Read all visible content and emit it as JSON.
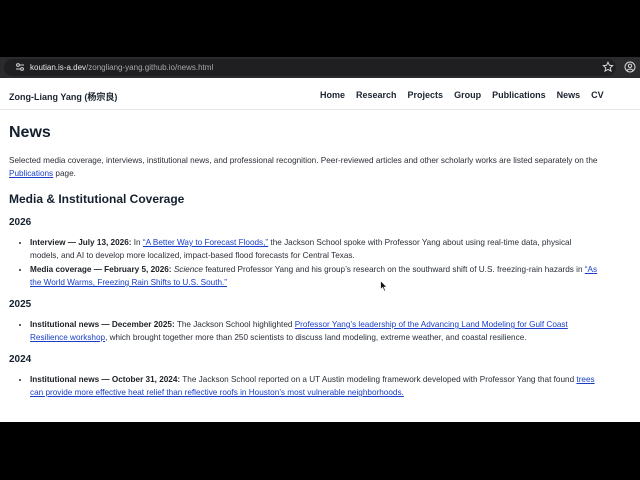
{
  "browser": {
    "url_host": "koutian.is-a.dev",
    "url_path": "/zongliang-yang.github.io/news.html"
  },
  "nav": {
    "brand": "Zong-Liang Yang (杨宗良)",
    "links": [
      "Home",
      "Research",
      "Projects",
      "Group",
      "Publications",
      "News",
      "CV"
    ]
  },
  "page": {
    "title": "News",
    "intro_before": "Selected media coverage, interviews, institutional news, and professional recognition. Peer-reviewed articles and other scholarly works are listed separately on the ",
    "intro_link": "Publications",
    "intro_after": " page.",
    "section_title": "Media & Institutional Coverage",
    "years": [
      {
        "year": "2026",
        "items": [
          {
            "label": "Interview — July 13, 2026:",
            "pre": " In ",
            "italic": "",
            "link": "“A Better Way to Forecast Floods,”",
            "post": " the Jackson School spoke with Professor Yang about using real-time data, physical models, and AI to develop more localized, impact-based flood forecasts for Central Texas."
          },
          {
            "label": "Media coverage — February 5, 2026:",
            "pre": " ",
            "italic": "Science",
            "mid": " featured Professor Yang and his group’s research on the southward shift of U.S. freezing-rain hazards in ",
            "link": "“As the World Warms, Freezing Rain Shifts to U.S. South.”",
            "post": ""
          }
        ]
      },
      {
        "year": "2025",
        "items": [
          {
            "label": "Institutional news — December 2025:",
            "pre": " The Jackson School highlighted ",
            "italic": "",
            "link": "Professor Yang’s leadership of the Advancing Land Modeling for Gulf Coast Resilience workshop",
            "post": ", which brought together more than 250 scientists to discuss land modeling, extreme weather, and coastal resilience."
          }
        ]
      },
      {
        "year": "2024",
        "items": [
          {
            "label": "Institutional news — October 31, 2024:",
            "pre": " The Jackson School reported on a UT Austin modeling framework developed with Professor Yang that found ",
            "italic": "",
            "link": "trees can provide more effective heat relief than reflective roofs in Houston’s most vulnerable neighborhoods.",
            "post": ""
          }
        ]
      }
    ]
  }
}
